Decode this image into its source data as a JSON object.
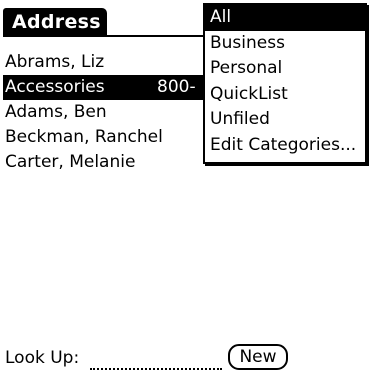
{
  "app": {
    "title": "Address"
  },
  "contacts": [
    {
      "name": "Abrams, Liz",
      "phone": ""
    },
    {
      "name": "Accessories",
      "phone": "800-"
    },
    {
      "name": "Adams, Ben",
      "phone": ""
    },
    {
      "name": "Beckman, Ranchel",
      "phone": ""
    },
    {
      "name": "Carter, Melanie",
      "phone": ""
    }
  ],
  "category_menu": {
    "items": [
      "All",
      "Business",
      "Personal",
      "QuickList",
      "Unfiled",
      "Edit Categories..."
    ],
    "selected": "All"
  },
  "lookup": {
    "label": "Look Up:",
    "value": ""
  },
  "buttons": {
    "new_label": "New"
  }
}
